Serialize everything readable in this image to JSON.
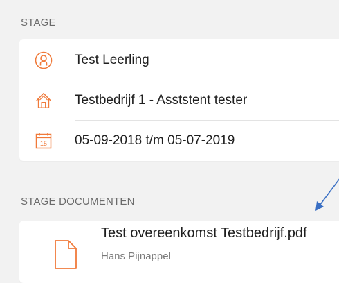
{
  "stage": {
    "header": "STAGE",
    "rows": [
      {
        "icon": "user-circle-icon",
        "text": "Test Leerling"
      },
      {
        "icon": "house-icon",
        "text": "Testbedrijf 1 - Asststent tester"
      },
      {
        "icon": "calendar-icon",
        "calendar_day": "15",
        "text": "05-09-2018 t/m 05-07-2019"
      }
    ]
  },
  "documents": {
    "header": "STAGE DOCUMENTEN",
    "items": [
      {
        "icon": "file-icon",
        "title": "Test overeenkomst Testbedrijf.pdf",
        "author": "Hans Pijnappel"
      }
    ]
  },
  "colors": {
    "background": "#f2f2f2",
    "card": "#ffffff",
    "accent": "#f07a3a",
    "arrow": "#3a6fc4",
    "header_text": "#6b6b6b"
  }
}
